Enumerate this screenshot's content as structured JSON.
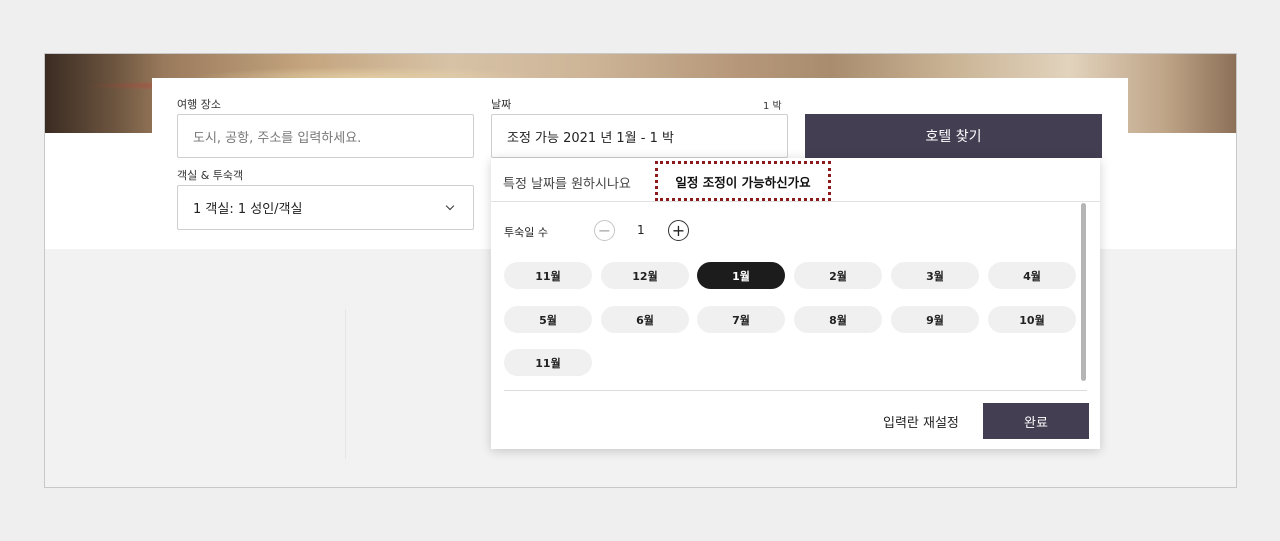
{
  "search": {
    "destination": {
      "label": "여행 장소",
      "placeholder": "도시, 공항, 주소를 입력하세요."
    },
    "dates": {
      "label": "날짜",
      "nights_hint": "1 박",
      "value": "조정 가능 2021 년 1월 - 1 박"
    },
    "rooms": {
      "label": "객실 & 투숙객",
      "value": "1 객실: 1 성인/객실"
    },
    "submit_label": "호텔 찾기"
  },
  "date_picker": {
    "tabs": [
      {
        "label": "특정 날짜를 원하시나요",
        "active": false
      },
      {
        "label": "일정 조정이 가능하신가요",
        "active": true
      }
    ],
    "nights": {
      "label": "투숙일 수",
      "value": "1",
      "minus": "−",
      "plus": "+"
    },
    "months": [
      {
        "label": "11월",
        "selected": false
      },
      {
        "label": "12월",
        "selected": false
      },
      {
        "label": "1월",
        "selected": true
      },
      {
        "label": "2월",
        "selected": false
      },
      {
        "label": "3월",
        "selected": false
      },
      {
        "label": "4월",
        "selected": false
      },
      {
        "label": "5월",
        "selected": false
      },
      {
        "label": "6월",
        "selected": false
      },
      {
        "label": "7월",
        "selected": false
      },
      {
        "label": "8월",
        "selected": false
      },
      {
        "label": "9월",
        "selected": false
      },
      {
        "label": "10월",
        "selected": false
      },
      {
        "label": "11월",
        "selected": false
      }
    ],
    "reset_label": "입력란 재설정",
    "done_label": "완료"
  },
  "colors": {
    "primary_button": "#433e52",
    "selected_month": "#1c1c1c",
    "highlight_border": "#8b1a1a"
  }
}
